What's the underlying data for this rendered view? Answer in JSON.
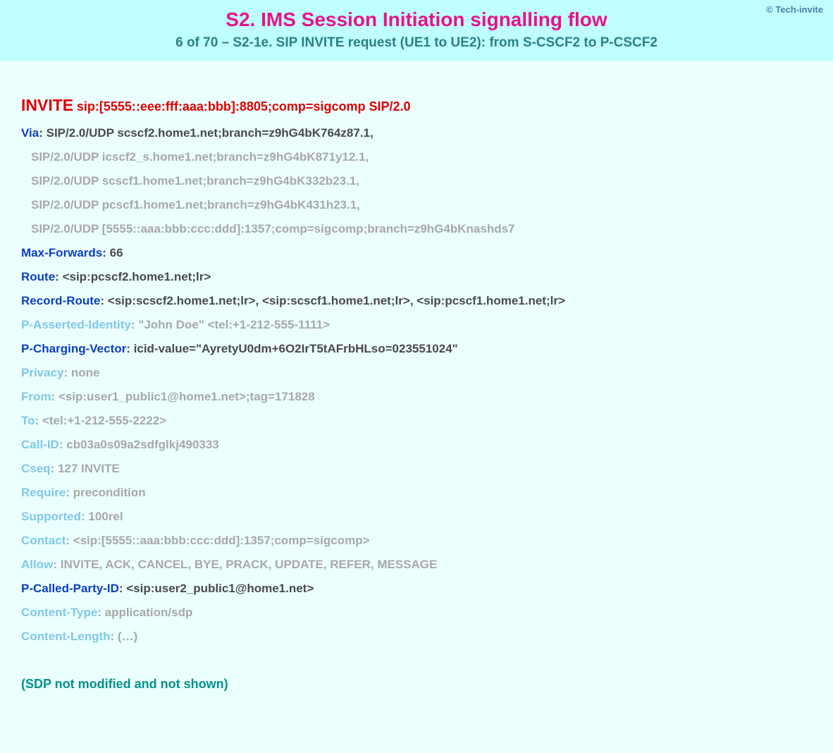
{
  "header": {
    "copyright": "© Tech-invite",
    "title": "S2. IMS Session Initiation signalling flow",
    "subtitle": "6 of 70 – S2-1e. SIP INVITE request (UE1 to UE2): from S-CSCF2 to P-CSCF2"
  },
  "request": {
    "method": "INVITE",
    "uri": "sip:[5555::eee:fff:aaa:bbb]:8805;comp=sigcomp SIP/2.0"
  },
  "via": {
    "label": "Via",
    "first": "SIP/2.0/UDP scscf2.home1.net;branch=z9hG4bK764z87.1,",
    "rest": [
      "SIP/2.0/UDP icscf2_s.home1.net;branch=z9hG4bK871y12.1,",
      "SIP/2.0/UDP scscf1.home1.net;branch=z9hG4bK332b23.1,",
      "SIP/2.0/UDP pcscf1.home1.net;branch=z9hG4bK431h23.1,",
      "SIP/2.0/UDP [5555::aaa:bbb:ccc:ddd]:1357;comp=sigcomp;branch=z9hG4bKnashds7"
    ]
  },
  "headers": [
    {
      "label": "Max-Forwards",
      "value": "66",
      "labelStyle": "dark",
      "valueStyle": "dark"
    },
    {
      "label": "Route",
      "value": "<sip:pcscf2.home1.net;lr>",
      "labelStyle": "dark",
      "valueStyle": "dark"
    },
    {
      "label": "Record-Route",
      "value": "<sip:scscf2.home1.net;lr>, <sip:scscf1.home1.net;lr>, <sip:pcscf1.home1.net;lr>",
      "labelStyle": "dark",
      "valueStyle": "dark"
    },
    {
      "label": "P-Asserted-Identity",
      "value": "\"John Doe\" <tel:+1-212-555-1111>",
      "labelStyle": "light",
      "valueStyle": "light"
    },
    {
      "label": "P-Charging-Vector",
      "value": "icid-value=\"AyretyU0dm+6O2IrT5tAFrbHLso=023551024\"",
      "labelStyle": "dark",
      "valueStyle": "dark"
    },
    {
      "label": "Privacy",
      "value": "none",
      "labelStyle": "light",
      "valueStyle": "light"
    },
    {
      "label": "From",
      "value": "<sip:user1_public1@home1.net>;tag=171828",
      "labelStyle": "light",
      "valueStyle": "light"
    },
    {
      "label": "To",
      "value": "<tel:+1-212-555-2222>",
      "labelStyle": "light",
      "valueStyle": "light"
    },
    {
      "label": "Call-ID",
      "value": "cb03a0s09a2sdfglkj490333",
      "labelStyle": "light",
      "valueStyle": "light"
    },
    {
      "label": "Cseq",
      "value": "127 INVITE",
      "labelStyle": "light",
      "valueStyle": "light"
    },
    {
      "label": "Require",
      "value": "precondition",
      "labelStyle": "light",
      "valueStyle": "light"
    },
    {
      "label": "Supported",
      "value": "100rel",
      "labelStyle": "light",
      "valueStyle": "light"
    },
    {
      "label": "Contact",
      "value": "<sip:[5555::aaa:bbb:ccc:ddd]:1357;comp=sigcomp>",
      "labelStyle": "light",
      "valueStyle": "light"
    },
    {
      "label": "Allow",
      "value": "INVITE, ACK, CANCEL, BYE, PRACK, UPDATE, REFER, MESSAGE",
      "labelStyle": "light",
      "valueStyle": "light"
    },
    {
      "label": "P-Called-Party-ID",
      "value": "<sip:user2_public1@home1.net>",
      "labelStyle": "dark",
      "valueStyle": "dark"
    },
    {
      "label": "Content-Type",
      "value": "application/sdp",
      "labelStyle": "light",
      "valueStyle": "light"
    },
    {
      "label": "Content-Length",
      "value": "(…)",
      "labelStyle": "light",
      "valueStyle": "light"
    }
  ],
  "footnote": "(SDP not modified and not shown)"
}
